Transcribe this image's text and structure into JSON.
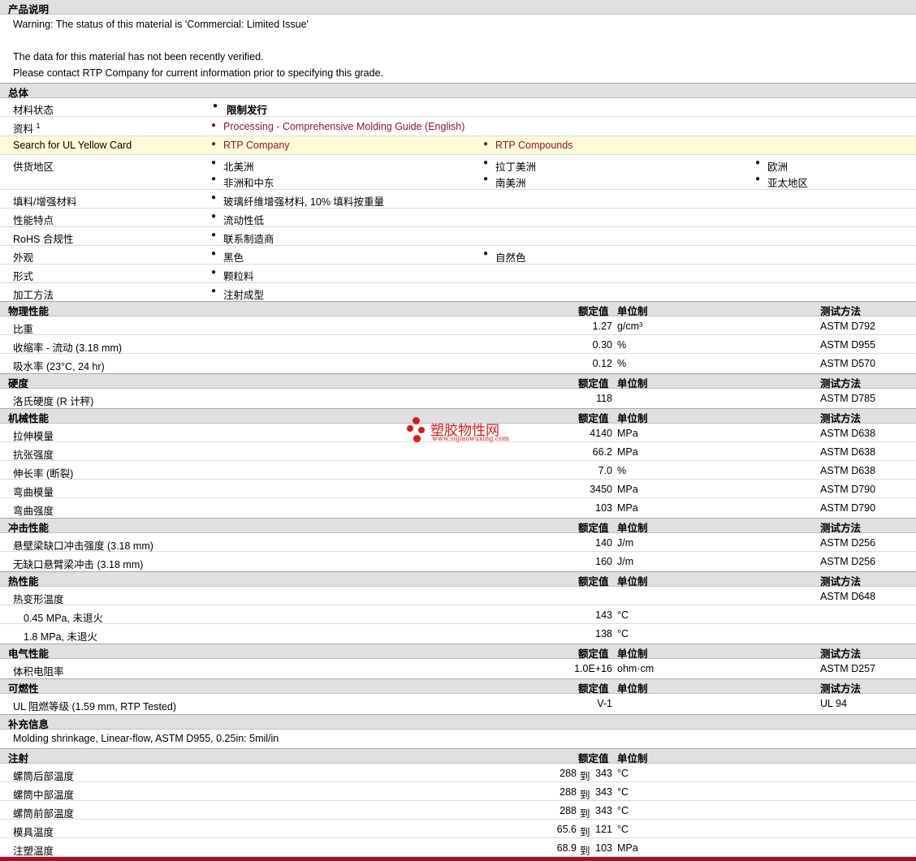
{
  "product": {
    "title": "产品说明",
    "warning": "Warning: The status of this material is 'Commercial: Limited Issue'",
    "line1": "The data for this material has not been recently verified.",
    "line2": "Please contact RTP Company for current information prior to specifying this grade."
  },
  "general": {
    "title": "总体",
    "status_label": "材料状态",
    "status_value": "限制发行",
    "docs_label": "资料",
    "docs_sup": "1",
    "docs_link": "Processing - Comprehensive Molding Guide (English)",
    "ul_label": "Search for UL Yellow Card",
    "ul_link1": "RTP Company",
    "ul_link2": "RTP Compounds",
    "supply_label": "供货地区",
    "supply": [
      "北美洲",
      "拉丁美洲",
      "欧洲",
      "非洲和中东",
      "南美洲",
      "亚太地区"
    ],
    "filler_label": "填料/增强材料",
    "filler_value": "玻璃纤维增强材料, 10% 填料按重量",
    "feature_label": "性能特点",
    "feature_value": "流动性低",
    "rohs_label": "RoHS 合规性",
    "rohs_value": "联系制造商",
    "appearance_label": "外观",
    "appearance": [
      "黑色",
      "自然色"
    ],
    "form_label": "形式",
    "form_value": "颗粒料",
    "process_label": "加工方法",
    "process_value": "注射成型"
  },
  "headers": {
    "value": "额定值",
    "unit": "单位制",
    "method": "测试方法"
  },
  "physical": {
    "title": "物理性能",
    "rows": [
      {
        "name": "比重",
        "value": "1.27",
        "unit": "g/cm³",
        "method": "ASTM D792"
      },
      {
        "name": "收缩率  - 流动  (3.18 mm)",
        "value": "0.30",
        "unit": "%",
        "method": "ASTM D955"
      },
      {
        "name": "吸水率  (23°C, 24 hr)",
        "value": "0.12",
        "unit": "%",
        "method": "ASTM D570"
      }
    ]
  },
  "hardness": {
    "title": "硬度",
    "rows": [
      {
        "name": "洛氏硬度  (R 计秤)",
        "value": "118",
        "unit": "",
        "method": "ASTM D785"
      }
    ]
  },
  "mechanical": {
    "title": "机械性能",
    "rows": [
      {
        "name": "拉伸模量",
        "value": "4140",
        "unit": "MPa",
        "method": "ASTM D638"
      },
      {
        "name": "抗张强度",
        "value": "66.2",
        "unit": "MPa",
        "method": "ASTM D638"
      },
      {
        "name": "伸长率  (断裂)",
        "value": "7.0",
        "unit": "%",
        "method": "ASTM D638"
      },
      {
        "name": "弯曲模量",
        "value": "3450",
        "unit": "MPa",
        "method": "ASTM D790"
      },
      {
        "name": "弯曲强度",
        "value": "103",
        "unit": "MPa",
        "method": "ASTM D790"
      }
    ]
  },
  "impact": {
    "title": "冲击性能",
    "rows": [
      {
        "name": "悬壁梁缺口冲击强度  (3.18 mm)",
        "value": "140",
        "unit": "J/m",
        "method": "ASTM D256"
      },
      {
        "name": "无缺口悬臂梁冲击  (3.18 mm)",
        "value": "160",
        "unit": "J/m",
        "method": "ASTM D256"
      }
    ]
  },
  "thermal": {
    "title": "热性能",
    "rows": [
      {
        "name": "热变形温度",
        "value": "",
        "unit": "",
        "method": "ASTM D648"
      },
      {
        "name": "0.45 MPa, 未退火",
        "value": "143",
        "unit": "°C",
        "method": ""
      },
      {
        "name": "1.8 MPa, 未退火",
        "value": "138",
        "unit": "°C",
        "method": ""
      }
    ]
  },
  "electrical": {
    "title": "电气性能",
    "rows": [
      {
        "name": "体积电阻率",
        "value": "1.0E+16",
        "unit": "ohm·cm",
        "method": "ASTM D257"
      }
    ]
  },
  "flammability": {
    "title": "可燃性",
    "rows": [
      {
        "name": "UL 阻燃等级  (1.59 mm, RTP Tested)",
        "value": "V-1",
        "unit": "",
        "method": "UL 94"
      }
    ]
  },
  "supplement": {
    "title": "补充信息",
    "text": "Molding shrinkage, Linear-flow, ASTM D955, 0.25in: 5mil/in"
  },
  "injection": {
    "title": "注射",
    "to": "到",
    "rows": [
      {
        "name": "螺筒后部温度",
        "low": "288",
        "high": "343",
        "unit": "°C"
      },
      {
        "name": "螺筒中部温度",
        "low": "288",
        "high": "343",
        "unit": "°C"
      },
      {
        "name": "螺筒前部温度",
        "low": "288",
        "high": "343",
        "unit": "°C"
      },
      {
        "name": "模具温度",
        "low": "65.6",
        "high": "121",
        "unit": "°C"
      },
      {
        "name": "注塑温度",
        "low": "68.9",
        "high": "103",
        "unit": "MPa"
      }
    ]
  },
  "watermark": {
    "cn": "塑胶物性网",
    "en": "www.sujiaowuxing.com"
  }
}
